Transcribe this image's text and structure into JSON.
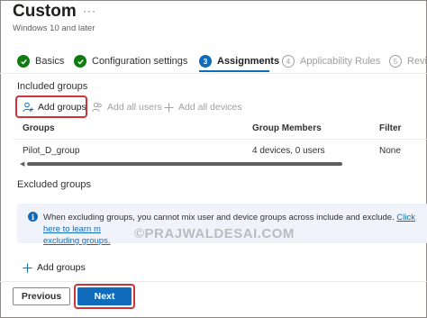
{
  "header": {
    "title": "Custom",
    "ellipsis": "···",
    "subtitle": "Windows 10 and later"
  },
  "steps": [
    {
      "number": "",
      "label": "Basics",
      "state": "done"
    },
    {
      "number": "",
      "label": "Configuration settings",
      "state": "done"
    },
    {
      "number": "3",
      "label": "Assignments",
      "state": "current"
    },
    {
      "number": "4",
      "label": "Applicability Rules",
      "state": "future"
    },
    {
      "number": "5",
      "label": "Revie",
      "state": "future"
    }
  ],
  "included": {
    "heading": "Included groups",
    "add_groups": "Add groups",
    "add_all_users": "Add all users",
    "add_all_devices": "Add all devices",
    "columns": [
      "Groups",
      "Group Members",
      "Filter"
    ],
    "rows": [
      {
        "group": "Pilot_D_group",
        "members": "4 devices, 0 users",
        "filter": "None"
      }
    ]
  },
  "excluded": {
    "heading": "Excluded groups",
    "info_text": "When excluding groups, you cannot mix user and device groups across include and exclude.",
    "info_link_1": "Click here to learn m",
    "info_link_2": "excluding groups.",
    "add_groups": "Add groups"
  },
  "watermark": "©PRAJWALDESAI.COM",
  "footer": {
    "previous": "Previous",
    "next": "Next"
  },
  "colors": {
    "accent": "#0f6cbd",
    "success": "#107c10",
    "highlight": "#d13438",
    "info_bg": "#f0f4fa"
  }
}
